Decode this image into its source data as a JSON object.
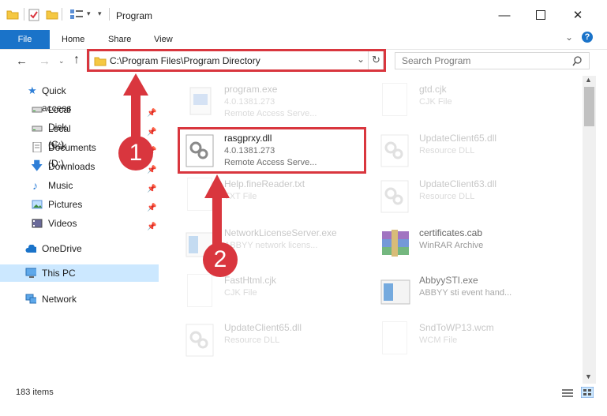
{
  "window": {
    "title": "Program"
  },
  "ribbon": {
    "file": "File",
    "home": "Home",
    "share": "Share",
    "view": "View"
  },
  "address": {
    "path": "C:\\Program Files\\Program Directory"
  },
  "search": {
    "placeholder": "Search Program"
  },
  "nav": {
    "quick_access": "Quick access",
    "items": [
      {
        "label": "Local Disk (C:)",
        "icon": "drive-icon",
        "pinned": true
      },
      {
        "label": "Local Disk (D:)",
        "icon": "drive-icon",
        "pinned": true
      },
      {
        "label": "Documents",
        "icon": "documents-icon",
        "pinned": true
      },
      {
        "label": "Downloads",
        "icon": "downloads-icon",
        "pinned": true
      },
      {
        "label": "Music",
        "icon": "music-icon",
        "pinned": true
      },
      {
        "label": "Pictures",
        "icon": "pictures-icon",
        "pinned": true
      },
      {
        "label": "Videos",
        "icon": "videos-icon",
        "pinned": true
      }
    ],
    "onedrive": "OneDrive",
    "this_pc": "This PC",
    "network": "Network"
  },
  "files": [
    {
      "name": "program.exe",
      "line2": "4.0.1381.273",
      "line3": "Remote Access Serve..."
    },
    {
      "name": "gtd.cjk",
      "line2": "CJK File",
      "line3": ""
    },
    {
      "name": "rasgprxy.dll",
      "line2": "4.0.1381.273",
      "line3": "Remote Access Serve..."
    },
    {
      "name": "UpdateClient65.dll",
      "line2": "Resource DLL",
      "line3": ""
    },
    {
      "name": "Help.fineReader.txt",
      "line2": "TXT File",
      "line3": ""
    },
    {
      "name": "UpdateClient63.dll",
      "line2": "Resource DLL",
      "line3": ""
    },
    {
      "name": "NetworkLicenseServer.exe",
      "line2": "ABBYY network licens...",
      "line3": ""
    },
    {
      "name": "certificates.cab",
      "line2": "WinRAR Archive",
      "line3": ""
    },
    {
      "name": "FastHtml.cjk",
      "line2": "CJK File",
      "line3": ""
    },
    {
      "name": "AbbyySTI.exe",
      "line2": "ABBYY sti event hand...",
      "line3": ""
    },
    {
      "name": "UpdateClient65.dll",
      "line2": "Resource DLL",
      "line3": ""
    },
    {
      "name": "SndToWP13.wcm",
      "line2": "WCM File",
      "line3": ""
    }
  ],
  "status": {
    "count": "183 items"
  },
  "callouts": {
    "one": "1",
    "two": "2"
  },
  "colors": {
    "accent": "#1a73c9",
    "highlight": "#d9363e",
    "selected": "#cce8ff"
  }
}
